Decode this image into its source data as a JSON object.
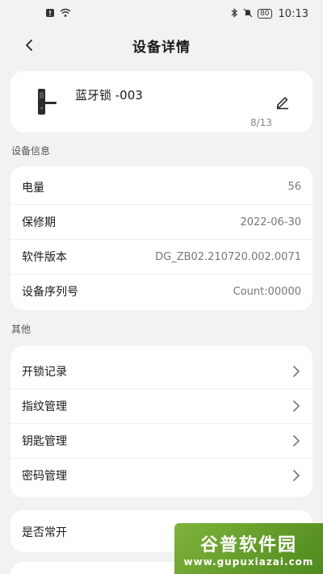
{
  "status_bar": {
    "battery": "80",
    "time": "10:13",
    "icons": [
      "sim-alert-icon",
      "wifi-icon",
      "bluetooth-icon",
      "mute-icon",
      "battery-icon"
    ]
  },
  "header": {
    "title": "设备详情",
    "back_icon": "chevron-left-icon"
  },
  "device": {
    "name": "蓝牙锁 -003",
    "count": "8/13",
    "image_icon": "door-lock-icon",
    "edit_icon": "pencil-icon"
  },
  "sections": {
    "device_info_label": "设备信息",
    "other_label": "其他"
  },
  "device_info": [
    {
      "label": "电量",
      "value": "56"
    },
    {
      "label": "保修期",
      "value": "2022-06-30"
    },
    {
      "label": "软件版本",
      "value": "DG_ZB02.210720.002.0071"
    },
    {
      "label": "设备序列号",
      "value": "Count:00000"
    }
  ],
  "other": [
    {
      "label": "开锁记录"
    },
    {
      "label": "指纹管理"
    },
    {
      "label": "钥匙管理"
    },
    {
      "label": "密码管理"
    }
  ],
  "toggle_row": {
    "label": "是否常开"
  },
  "watermark": {
    "title": "谷普软件园",
    "url": "www.gupuxiazai.com"
  },
  "colors": {
    "background": "#f2f2f2",
    "card": "#ffffff",
    "watermark": "#6aa22e"
  }
}
